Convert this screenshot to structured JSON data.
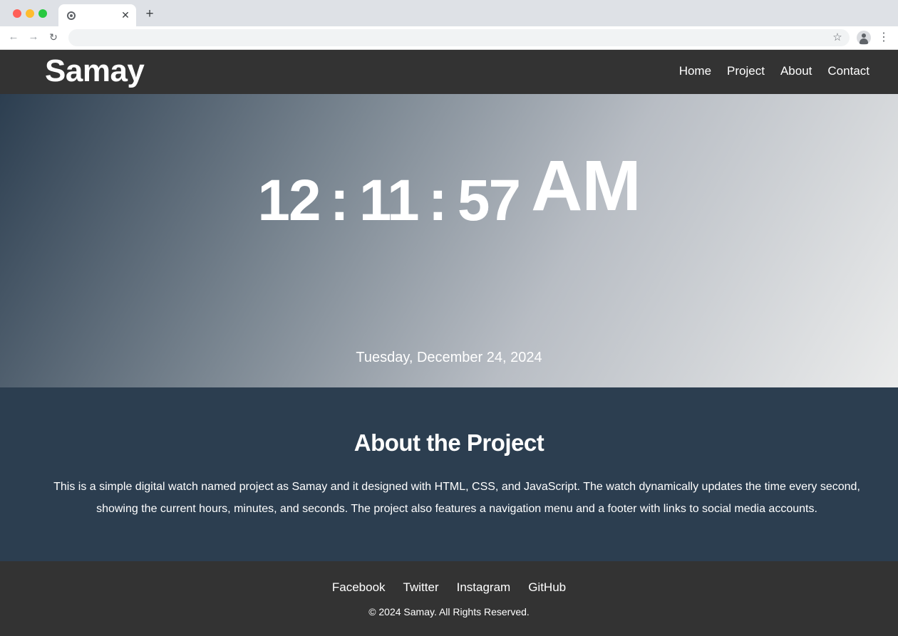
{
  "browser": {
    "tab_title": "",
    "tab_close": "✕",
    "new_tab": "+",
    "address_value": "",
    "icons": [
      "back-arrow-icon",
      "forward-arrow-icon",
      "reload-icon",
      "star-icon",
      "profile-icon",
      "more-vert-icon",
      "close-icon",
      "plus-icon"
    ]
  },
  "header": {
    "logo": "Samay",
    "nav": [
      "Home",
      "Project",
      "About",
      "Contact"
    ]
  },
  "clock": {
    "hours": "12",
    "sep1": ":",
    "minutes": "11",
    "sep2": ":",
    "seconds": "57",
    "ampm": "AM",
    "date": "Tuesday, December 24, 2024"
  },
  "about": {
    "title": "About the Project",
    "text": "This is a simple digital watch named project as Samay and it designed with HTML, CSS, and JavaScript. The watch dynamically updates the time every second, showing the current hours, minutes, and seconds. The project also features a navigation menu and a footer with links to social media accounts."
  },
  "footer": {
    "links": [
      "Facebook",
      "Twitter",
      "Instagram",
      "GitHub"
    ],
    "copyright": "© 2024 Samay. All Rights Reserved."
  },
  "colors": {
    "header_bg": "#333333",
    "about_bg": "#2c3e50",
    "footer_bg": "#333333",
    "hero_gradient_start": "#2c3e50",
    "hero_gradient_end": "#ebecec",
    "text": "#ffffff"
  }
}
